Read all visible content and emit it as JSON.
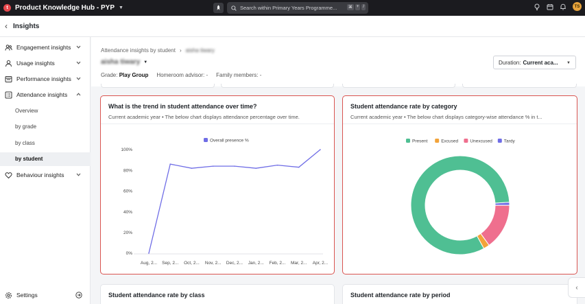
{
  "topbar": {
    "logo_letter": "t",
    "app_title": "Product Knowledge Hub - PYP",
    "search_placeholder": "Search within Primary Years Programme...",
    "shortcut": [
      "⌘",
      "+",
      "/"
    ],
    "avatar_initials": "TS"
  },
  "page": {
    "title": "Insights"
  },
  "sidebar": {
    "items": [
      {
        "label": "Engagement insights",
        "icon": "engagement-icon",
        "expanded": false
      },
      {
        "label": "Usage insights",
        "icon": "usage-icon",
        "expanded": false
      },
      {
        "label": "Performance insights",
        "icon": "performance-icon",
        "expanded": false
      },
      {
        "label": "Attendance insights",
        "icon": "attendance-icon",
        "expanded": true
      },
      {
        "label": "Behaviour insights",
        "icon": "heart-icon",
        "expanded": false
      }
    ],
    "attendance_sub": [
      {
        "label": "Overview",
        "active": false
      },
      {
        "label": "by grade",
        "active": false
      },
      {
        "label": "by class",
        "active": false
      },
      {
        "label": "by student",
        "active": true
      }
    ],
    "settings_label": "Settings"
  },
  "header": {
    "breadcrumb_parent": "Attendance insights by student",
    "breadcrumb_current": "aisha tiwary",
    "student_name": "aisha tiwary",
    "grade_label": "Grade:",
    "grade_value": "Play Group",
    "advisor_label": "Homeroom advisor:",
    "advisor_value": "-",
    "family_label": "Family members:",
    "family_value": "-",
    "duration_label": "Duration:",
    "duration_value": "Current aca..."
  },
  "cards": {
    "trend": {
      "title": "What is the trend in student attendance over time?",
      "subtitle": "Current academic year  •  The below chart displays attendance percentage over time."
    },
    "category": {
      "title": "Student attendance rate by category",
      "subtitle": "Current academic year  •  The below chart displays category-wise attendance % in t..."
    },
    "by_class": {
      "title": "Student attendance rate by class"
    },
    "by_period": {
      "title": "Student attendance rate by period"
    }
  },
  "colors": {
    "line": "#6f6de6",
    "present": "#4fbf93",
    "excused": "#f2a33a",
    "unexcused": "#ef6f8e",
    "tardy": "#6f6de6"
  },
  "chart_data": [
    {
      "type": "line",
      "x": [
        "Aug, 2...",
        "Sep, 2...",
        "Oct, 2...",
        "Nov, 2...",
        "Dec, 2...",
        "Jan, 2...",
        "Feb, 2...",
        "Mar, 2...",
        "Apr, 2..."
      ],
      "series": [
        {
          "name": "Overall presence %",
          "values": [
            0,
            86,
            82,
            84,
            84,
            82,
            85,
            83,
            100
          ]
        }
      ],
      "yticks": [
        "0%",
        "20%",
        "40%",
        "60%",
        "80%",
        "100%"
      ],
      "ylim": [
        0,
        100
      ],
      "legend": "top"
    },
    {
      "type": "pie",
      "donut": true,
      "categories": [
        "Present",
        "Excused",
        "Unexcused",
        "Tardy"
      ],
      "values": [
        82,
        2,
        15,
        1
      ],
      "legend": "top"
    }
  ]
}
